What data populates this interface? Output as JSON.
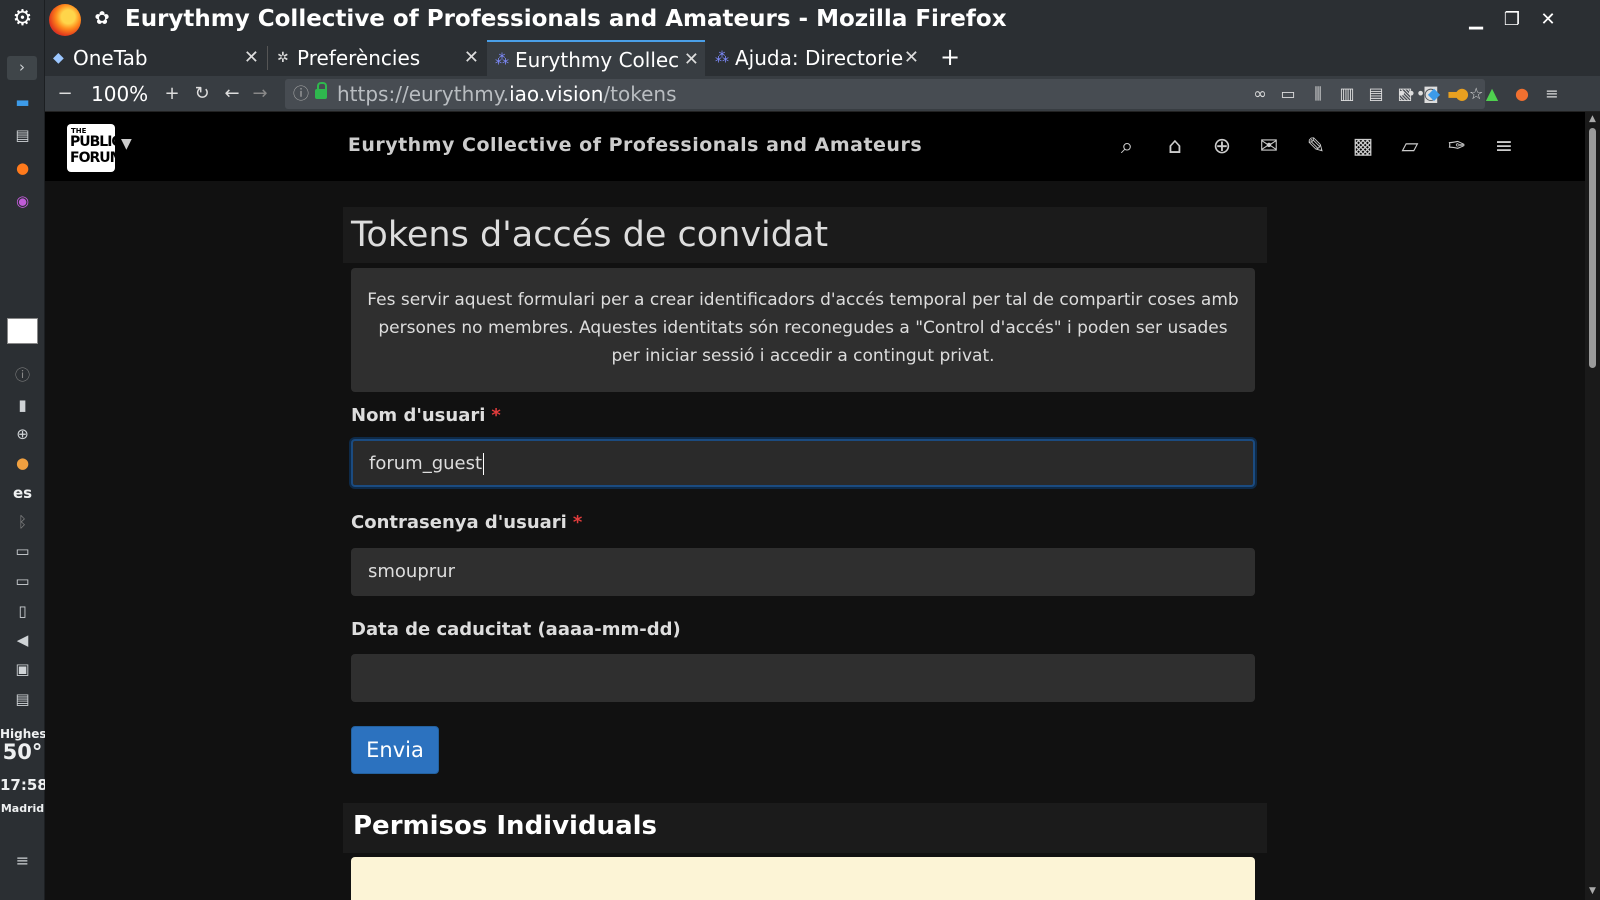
{
  "window": {
    "title": "Eurythmy Collective of Professionals and Amateurs - Mozilla Firefox"
  },
  "tabs": [
    {
      "label": "OneTab",
      "icon": "onetab-icon"
    },
    {
      "label": "Preferències",
      "icon": "gear-icon"
    },
    {
      "label": "Eurythmy Collec",
      "icon": "hubzilla-icon",
      "active": true
    },
    {
      "label": "Ajuda: Directorie",
      "icon": "hubzilla-icon"
    }
  ],
  "navbar": {
    "zoom": "100%",
    "url_prefix": "https://eurythmy.",
    "url_domain": "iao.vision",
    "url_path": "/tokens"
  },
  "kde_panel": {
    "lang": "es",
    "weather_label": "Highes",
    "temperature": "50°",
    "time": "17:58",
    "city": "Madrid"
  },
  "site": {
    "logo_top": "THE",
    "logo_mid": "PUBLIC",
    "logo_bottom": "FORUM",
    "name": "Eurythmy Collective of Professionals and Amateurs"
  },
  "main": {
    "heading": "Tokens d'accés de convidat",
    "description": "Fes servir aquest formulari per a crear identificadors d'accés temporal per tal de compartir coses amb persones no membres. Aquestes identitats són reconegudes a \"Control d'accés\" i poden ser usades per iniciar sessió i accedir a contingut privat.",
    "fields": [
      {
        "label": "Nom d'usuari",
        "required": "*",
        "value": "forum_guest"
      },
      {
        "label": "Contrasenya d'usuari",
        "required": "*",
        "value": "smouprur"
      },
      {
        "label": "Data de caducitat (aaaa-mm-dd)",
        "value": ""
      }
    ],
    "submit_label": "Envia",
    "permissions_heading": "Permisos Individuals"
  },
  "colors": {
    "accent": "#2c72bf",
    "required": "#e23c3c",
    "warning_bg": "#fcf4d6"
  }
}
